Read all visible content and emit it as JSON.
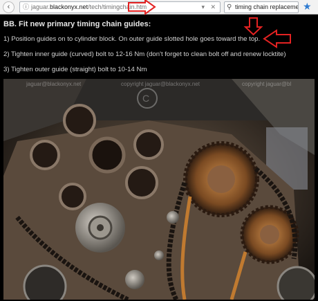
{
  "browser": {
    "url_prefix": "jaguar.",
    "url_host": "blackonyx.net",
    "url_path": "/tech/timingchain.htm",
    "search_query": "timing chain replacement",
    "info_icon": "info-icon",
    "search_icon": "search-icon",
    "bookmark_icon": "star-icon"
  },
  "page": {
    "heading": "BB. Fit new primary timing chain guides:",
    "steps": [
      "1) Position guides on to cylinder block. On outer guide slotted hole goes toward the top.",
      "2) Tighten inner guide (curved) bolt to 12-16 Nm (don't forget to clean bolt off and renew locktite)",
      "3) Tighten outer guide (straight) bolt to 10-14 Nm"
    ]
  },
  "photo": {
    "watermark_left": "jaguar@blackonyx.net",
    "watermark_center": "copyright  jaguar@blackonyx.net",
    "watermark_right": "copyright  jaguar@bl"
  },
  "colors": {
    "annotation_red": "#e32222",
    "background": "#000000",
    "text": "#d4d4d4"
  }
}
